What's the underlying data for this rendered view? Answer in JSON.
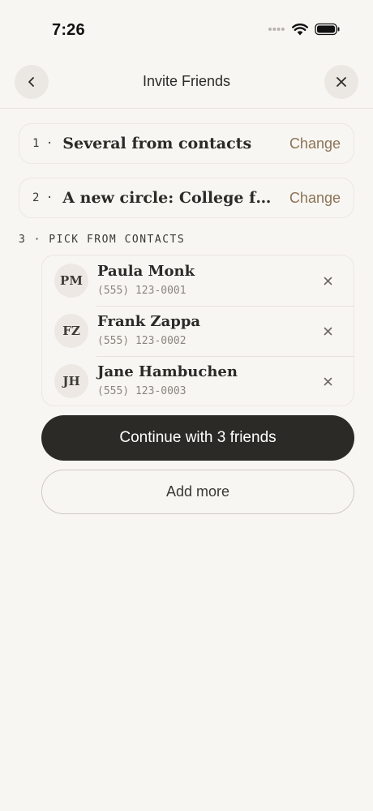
{
  "status_bar": {
    "time": "7:26",
    "icons": [
      "signal-dots-icon",
      "wifi-icon",
      "battery-icon"
    ]
  },
  "nav": {
    "title": "Invite Friends",
    "back_icon": "chevron-left-icon",
    "close_icon": "close-icon"
  },
  "steps": [
    {
      "number": "1 ·",
      "title": "Several from contacts",
      "action": "Change"
    },
    {
      "number": "2 ·",
      "title": "A new circle: College frie...",
      "action": "Change"
    }
  ],
  "section": {
    "label": "3 · PICK FROM CONTACTS"
  },
  "contacts": [
    {
      "initials": "PM",
      "name": "Paula Monk",
      "phone": "(555) 123-0001"
    },
    {
      "initials": "FZ",
      "name": "Frank Zappa",
      "phone": "(555) 123-0002"
    },
    {
      "initials": "JH",
      "name": "Jane Hambuchen",
      "phone": "(555) 123-0003"
    }
  ],
  "actions": {
    "continue_label": "Continue with 3 friends",
    "add_more_label": "Add more"
  },
  "colors": {
    "background": "#f8f6f3",
    "accent_link": "#8b7355",
    "primary_button": "#2c2a27"
  }
}
